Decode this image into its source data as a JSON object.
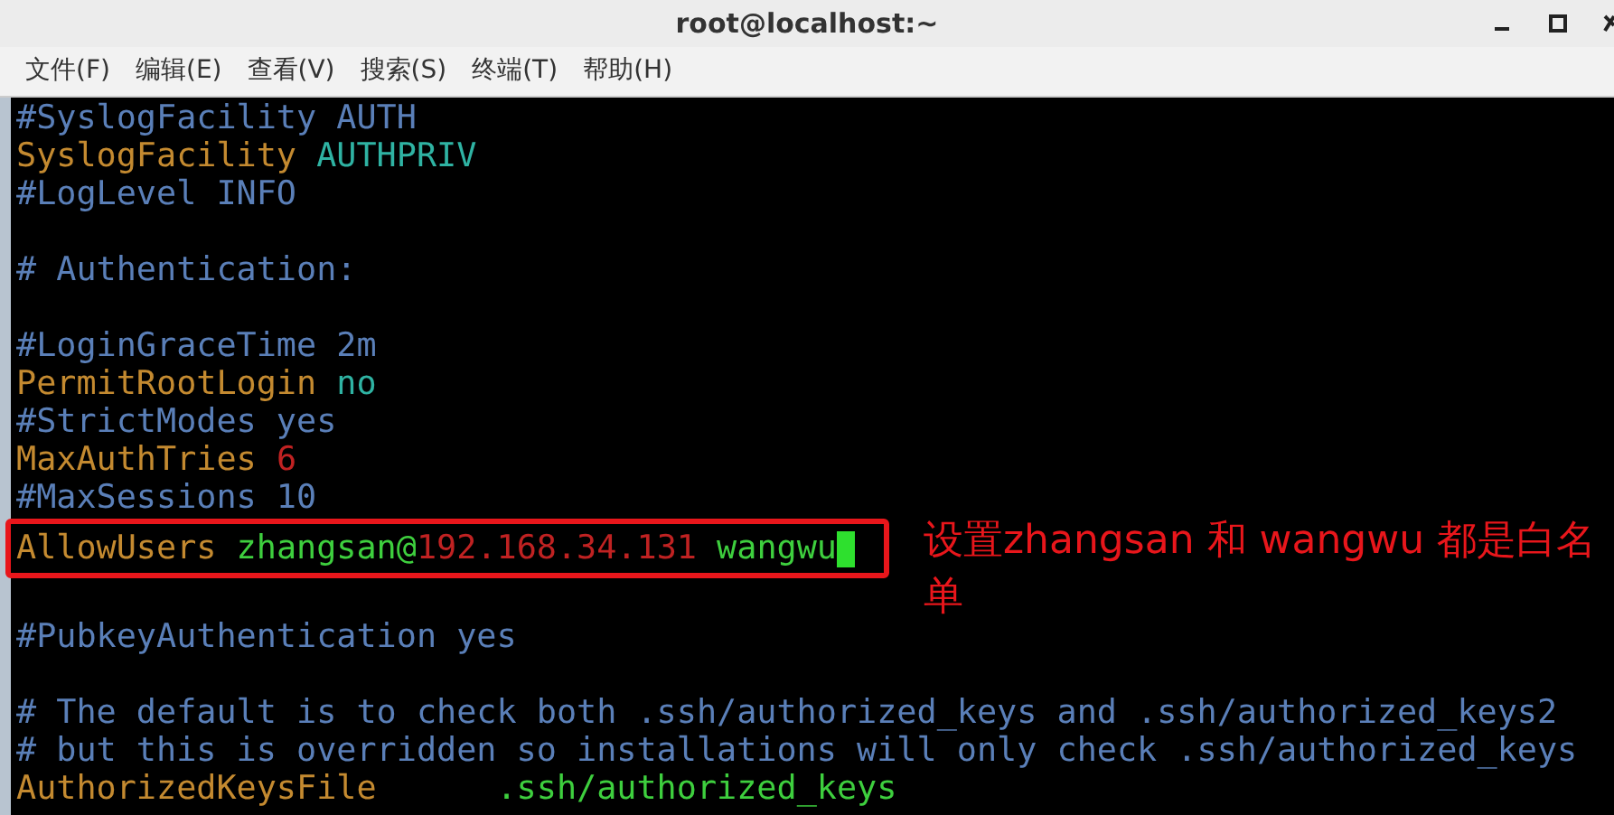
{
  "window": {
    "title": "root@localhost:~"
  },
  "menu": [
    "文件(F)",
    "编辑(E)",
    "查看(V)",
    "搜索(S)",
    "终端(T)",
    "帮助(H)"
  ],
  "lines": [
    {
      "kind": "code",
      "segments": [
        {
          "kind": "comment",
          "text": "#SyslogFacility AUTH"
        }
      ]
    },
    {
      "kind": "code",
      "segments": [
        {
          "kind": "keyword",
          "text": "SyslogFacility "
        },
        {
          "kind": "value",
          "text": "AUTHPRIV"
        }
      ]
    },
    {
      "kind": "code",
      "segments": [
        {
          "kind": "comment",
          "text": "#LogLevel INFO"
        }
      ]
    },
    {
      "kind": "blank"
    },
    {
      "kind": "code",
      "segments": [
        {
          "kind": "comment",
          "text": "# Authentication:"
        }
      ]
    },
    {
      "kind": "blank"
    },
    {
      "kind": "code",
      "segments": [
        {
          "kind": "comment",
          "text": "#LoginGraceTime 2m"
        }
      ]
    },
    {
      "kind": "code",
      "segments": [
        {
          "kind": "keyword",
          "text": "PermitRootLogin "
        },
        {
          "kind": "value",
          "text": "no"
        }
      ]
    },
    {
      "kind": "code",
      "segments": [
        {
          "kind": "comment",
          "text": "#StrictModes yes"
        }
      ]
    },
    {
      "kind": "code",
      "segments": [
        {
          "kind": "keyword",
          "text": "MaxAuthTries "
        },
        {
          "kind": "number",
          "text": "6"
        }
      ]
    },
    {
      "kind": "code",
      "segments": [
        {
          "kind": "comment",
          "text": "#MaxSessions 10"
        }
      ]
    },
    {
      "kind": "code",
      "highlighted": true,
      "cursor": true,
      "annotation": "设置zhangsan 和 wangwu 都是白名单",
      "segments": [
        {
          "kind": "keyword",
          "text": "AllowUsers "
        },
        {
          "kind": "string",
          "text": "zhangsan@"
        },
        {
          "kind": "number",
          "text": "192.168.34.131 "
        },
        {
          "kind": "string",
          "text": "wangwu"
        }
      ]
    },
    {
      "kind": "blank"
    },
    {
      "kind": "code",
      "segments": [
        {
          "kind": "comment",
          "text": "#PubkeyAuthentication yes"
        }
      ]
    },
    {
      "kind": "blank"
    },
    {
      "kind": "code",
      "segments": [
        {
          "kind": "comment",
          "text": "# The default is to check both .ssh/authorized_keys and .ssh/authorized_keys2"
        }
      ]
    },
    {
      "kind": "code",
      "segments": [
        {
          "kind": "comment",
          "text": "# but this is overridden so installations will only check .ssh/authorized_keys"
        }
      ]
    },
    {
      "kind": "code",
      "segments": [
        {
          "kind": "keyword",
          "text": "AuthorizedKeysFile      "
        },
        {
          "kind": "string",
          "text": ".ssh/authorized_keys"
        }
      ]
    }
  ]
}
